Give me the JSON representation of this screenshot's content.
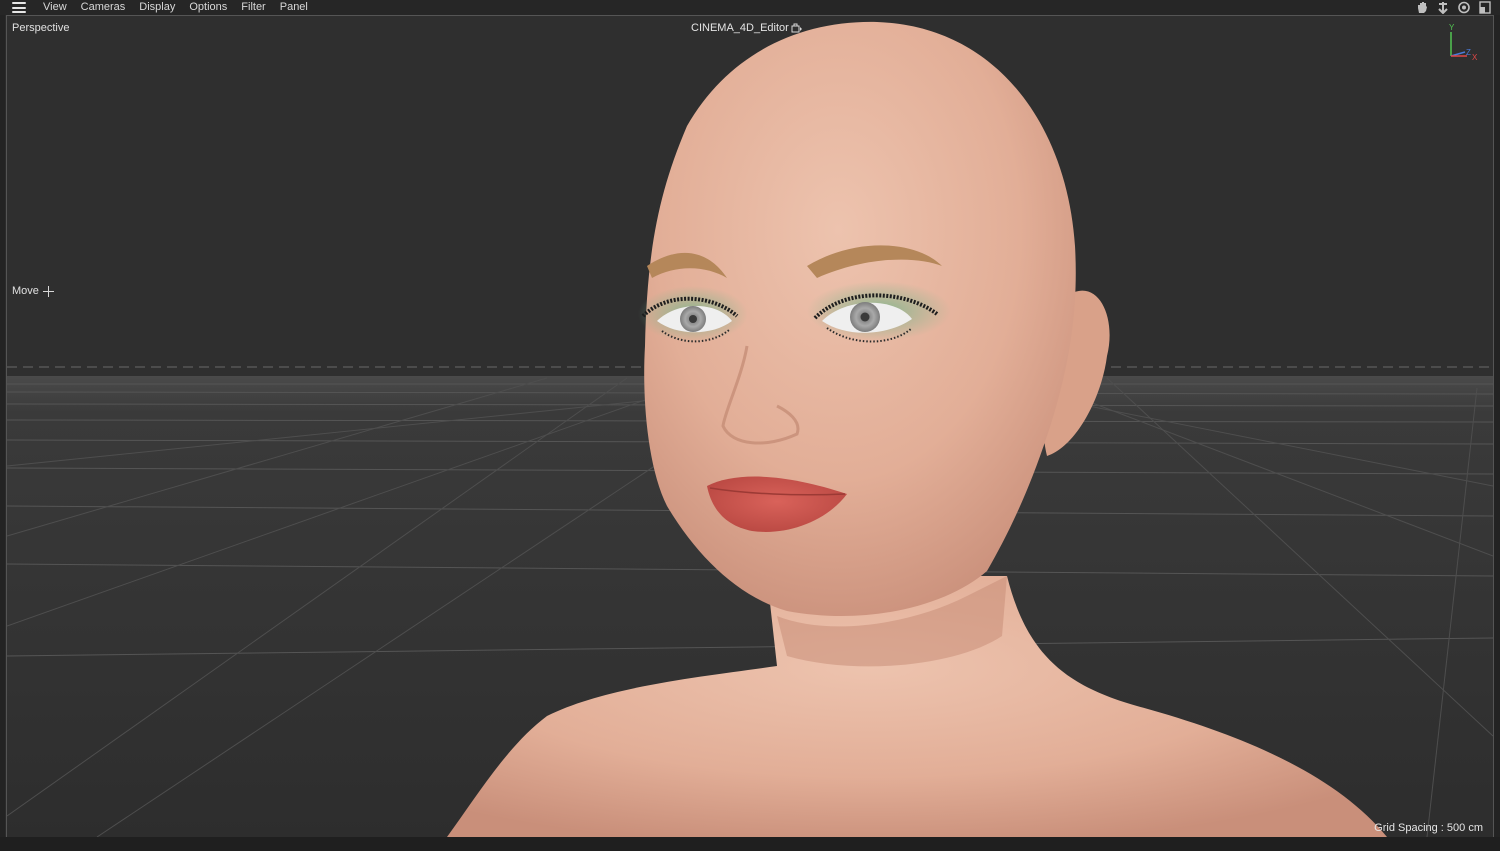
{
  "menubar": {
    "items": [
      "View",
      "Cameras",
      "Display",
      "Options",
      "Filter",
      "Panel"
    ]
  },
  "nav_icons": [
    "hand-pan-icon",
    "move-camera-icon",
    "rotate-camera-icon",
    "maximize-view-icon"
  ],
  "viewport": {
    "camera_label": "Perspective",
    "camera_name": "CINEMA_4D_Editor",
    "tool_label": "Move",
    "grid_spacing": "Grid Spacing : 500 cm",
    "axis": {
      "y": "Y",
      "z": "Z",
      "x": "X"
    }
  },
  "colors": {
    "background": "#2f2f2f",
    "axis_x": "#e04848",
    "axis_y": "#52c552",
    "axis_z": "#4a7ad8",
    "skin": "#e3b19a",
    "lips": "#c9504a",
    "eyeshadow": "#7fb58c"
  }
}
